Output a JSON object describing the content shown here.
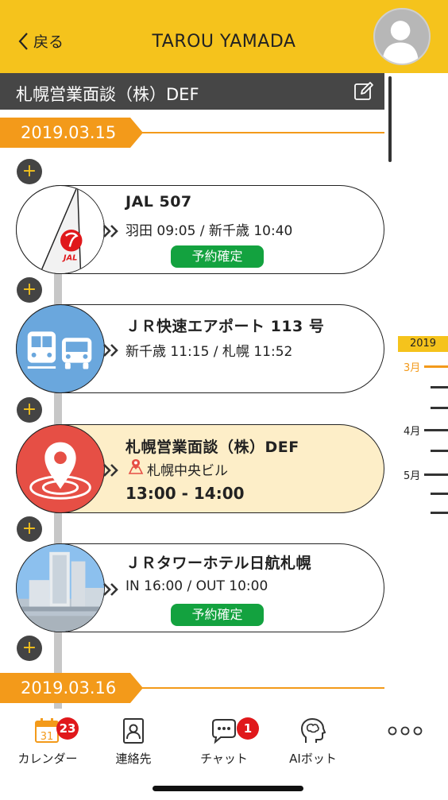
{
  "header": {
    "back_label": "戻る",
    "title": "TAROU YAMADA",
    "avatar_icon": "user-avatar-icon",
    "bg_color": "#f5c31c"
  },
  "event_title": "札幌営業面談（株）DEF",
  "dates": [
    "2019.03.15",
    "2019.03.16"
  ],
  "add_label": "+",
  "timeline": [
    {
      "kind": "flight",
      "icon": "jal-logo-icon",
      "logo_text": "JAL",
      "title": "JAL 507",
      "detail": "羽田 09:05 / 新千歳 10:40",
      "status": "予約確定"
    },
    {
      "kind": "train",
      "icon": "train-bus-icon",
      "title": "ＪＲ快速エアポート 113 号",
      "detail": "新千歳 11:15 / 札幌 11:52"
    },
    {
      "kind": "meeting",
      "icon": "location-pin-icon",
      "title": "札幌営業面談（株）DEF",
      "place": "札幌中央ビル",
      "time": "13:00 - 14:00"
    },
    {
      "kind": "hotel",
      "icon": "hotel-building-icon",
      "title": "ＪＲタワーホテル日航札幌",
      "detail": "IN 16:00 / OUT 10:00",
      "status": "予約確定"
    }
  ],
  "month_scale": {
    "year": "2019",
    "months": [
      "3月",
      "4月",
      "5月"
    ]
  },
  "nav": {
    "calendar": {
      "label": "カレンダー",
      "icon_text": "31",
      "badge": "23"
    },
    "contacts": {
      "label": "連絡先"
    },
    "chat": {
      "label": "チャット",
      "badge": "1"
    },
    "aibot": {
      "label": "AIボット"
    },
    "more_icon": "more-dots-icon"
  },
  "colors": {
    "accent": "#f39a1a",
    "confirm": "#13a23f",
    "active_card": "#fdeec8",
    "badge": "#e0181b"
  }
}
